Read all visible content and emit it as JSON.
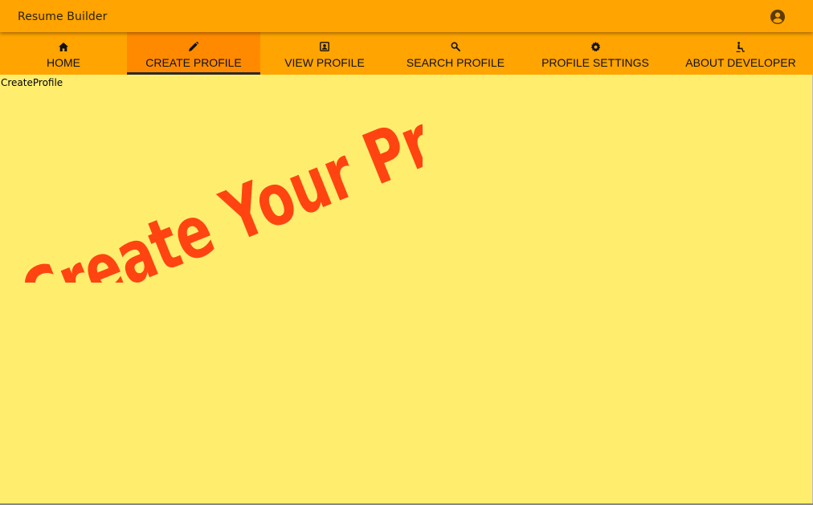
{
  "app": {
    "title": "Resume Builder",
    "account_icon": "account-circle-icon"
  },
  "tabs": [
    {
      "label": "HOME",
      "icon": "home-icon"
    },
    {
      "label": "CREATE PROFILE",
      "icon": "pencil-icon",
      "active": true
    },
    {
      "label": "VIEW PROFILE",
      "icon": "contact-card-icon"
    },
    {
      "label": "SEARCH PROFILE",
      "icon": "search-icon"
    },
    {
      "label": "PROFILE SETTINGS",
      "icon": "gear-icon"
    },
    {
      "label": "ABOUT DEVELOPER",
      "icon": "accessibility-icon"
    }
  ],
  "main": {
    "route_label": "CreateProfile",
    "banner_text": "Create Your Profile"
  },
  "colors": {
    "appbar": "#ffa400",
    "tab_active": "#ff8a00",
    "background": "#ffee6e",
    "banner_text": "#ff4411"
  }
}
